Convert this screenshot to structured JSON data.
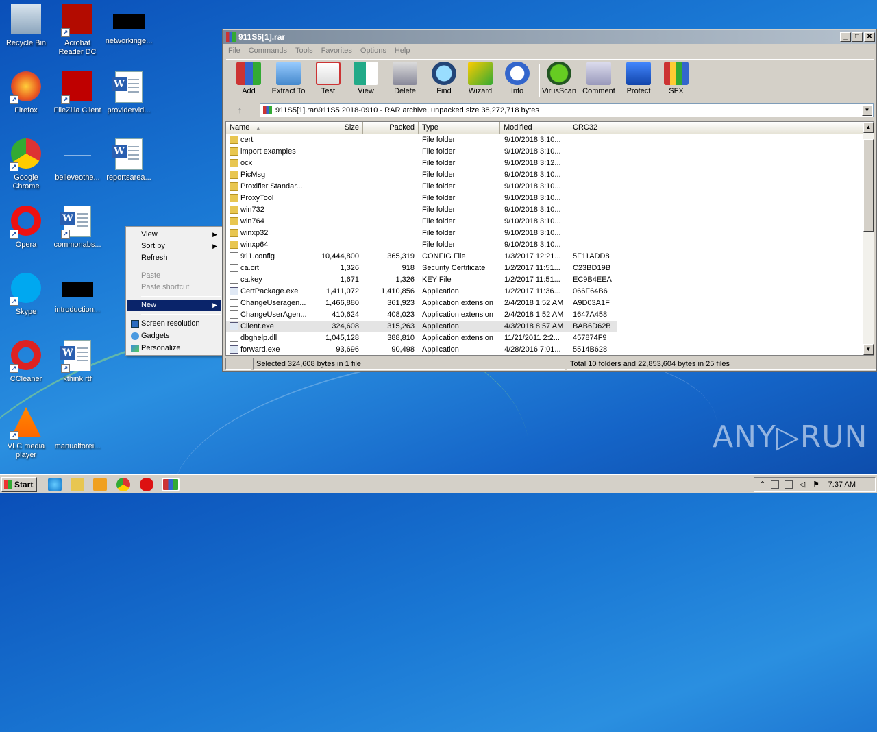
{
  "desktop": {
    "icons": [
      {
        "label": "Recycle Bin",
        "icon": "recycle-bin-icon"
      },
      {
        "label": "Acrobat Reader DC",
        "icon": "acrobat-icon"
      },
      {
        "label": "networkinge...",
        "icon": "redacted-icon"
      },
      {
        "label": "Firefox",
        "icon": "firefox-icon"
      },
      {
        "label": "FileZilla Client",
        "icon": "filezilla-icon"
      },
      {
        "label": "providervid...",
        "icon": "word-doc-icon"
      },
      {
        "label": "Google Chrome",
        "icon": "chrome-icon"
      },
      {
        "label": "believeothe...",
        "icon": "blank-icon"
      },
      {
        "label": "reportsarea...",
        "icon": "word-doc-icon"
      },
      {
        "label": "Opera",
        "icon": "opera-icon"
      },
      {
        "label": "commonabs...",
        "icon": "word-doc-icon"
      },
      {
        "label": "Skype",
        "icon": "skype-icon"
      },
      {
        "label": "introduction...",
        "icon": "redacted-icon"
      },
      {
        "label": "CCleaner",
        "icon": "ccleaner-icon"
      },
      {
        "label": "kthink.rtf",
        "icon": "word-doc-icon"
      },
      {
        "label": "VLC media player",
        "icon": "vlc-icon"
      },
      {
        "label": "manualforei...",
        "icon": "blank-icon"
      }
    ]
  },
  "context_menu": {
    "items": [
      {
        "label": "View",
        "sub": "▶"
      },
      {
        "label": "Sort by",
        "sub": "▶"
      },
      {
        "label": "Refresh"
      },
      {
        "label": "Paste"
      },
      {
        "label": "Paste shortcut"
      },
      {
        "label": "New",
        "sub": "▶"
      },
      {
        "label": "Screen resolution"
      },
      {
        "label": "Gadgets"
      },
      {
        "label": "Personalize"
      }
    ]
  },
  "window": {
    "title": "911S5[1].rar",
    "controls": {
      "minimize": "_",
      "maximize": "□",
      "close": "✕"
    },
    "menu": [
      "File",
      "Commands",
      "Tools",
      "Favorites",
      "Options",
      "Help"
    ],
    "toolbar": [
      "Add",
      "Extract To",
      "Test",
      "View",
      "Delete",
      "Find",
      "Wizard",
      "Info",
      "VirusScan",
      "Comment",
      "Protect",
      "SFX"
    ],
    "address": "911S5[1].rar\\911S5 2018-0910 - RAR archive, unpacked size 38,272,718 bytes",
    "up_arrow": "↑",
    "dropdown_arrow": "▼",
    "columns": [
      "Name",
      "Size",
      "Packed",
      "Type",
      "Modified",
      "CRC32"
    ],
    "sort_arrow": "▲",
    "rows": [
      {
        "name": "cert",
        "size": "",
        "packed": "",
        "type": "File folder",
        "modified": "9/10/2018 3:10...",
        "crc": "",
        "kind": "folder"
      },
      {
        "name": "import examples",
        "size": "",
        "packed": "",
        "type": "File folder",
        "modified": "9/10/2018 3:10...",
        "crc": "",
        "kind": "folder"
      },
      {
        "name": "ocx",
        "size": "",
        "packed": "",
        "type": "File folder",
        "modified": "9/10/2018 3:12...",
        "crc": "",
        "kind": "folder"
      },
      {
        "name": "PicMsg",
        "size": "",
        "packed": "",
        "type": "File folder",
        "modified": "9/10/2018 3:10...",
        "crc": "",
        "kind": "folder"
      },
      {
        "name": "Proxifier Standar...",
        "size": "",
        "packed": "",
        "type": "File folder",
        "modified": "9/10/2018 3:10...",
        "crc": "",
        "kind": "folder"
      },
      {
        "name": "ProxyTool",
        "size": "",
        "packed": "",
        "type": "File folder",
        "modified": "9/10/2018 3:10...",
        "crc": "",
        "kind": "folder"
      },
      {
        "name": "win732",
        "size": "",
        "packed": "",
        "type": "File folder",
        "modified": "9/10/2018 3:10...",
        "crc": "",
        "kind": "folder"
      },
      {
        "name": "win764",
        "size": "",
        "packed": "",
        "type": "File folder",
        "modified": "9/10/2018 3:10...",
        "crc": "",
        "kind": "folder"
      },
      {
        "name": "winxp32",
        "size": "",
        "packed": "",
        "type": "File folder",
        "modified": "9/10/2018 3:10...",
        "crc": "",
        "kind": "folder"
      },
      {
        "name": "winxp64",
        "size": "",
        "packed": "",
        "type": "File folder",
        "modified": "9/10/2018 3:10...",
        "crc": "",
        "kind": "folder"
      },
      {
        "name": "911.config",
        "size": "10,444,800",
        "packed": "365,319",
        "type": "CONFIG File",
        "modified": "1/3/2017 12:21...",
        "crc": "5F11ADD8",
        "kind": "file"
      },
      {
        "name": "ca.crt",
        "size": "1,326",
        "packed": "918",
        "type": "Security Certificate",
        "modified": "1/2/2017 11:51...",
        "crc": "C23BD19B",
        "kind": "file"
      },
      {
        "name": "ca.key",
        "size": "1,671",
        "packed": "1,326",
        "type": "KEY File",
        "modified": "1/2/2017 11:51...",
        "crc": "EC9B4EEA",
        "kind": "file"
      },
      {
        "name": "CertPackage.exe",
        "size": "1,411,072",
        "packed": "1,410,856",
        "type": "Application",
        "modified": "1/2/2017 11:36...",
        "crc": "066F64B6",
        "kind": "app"
      },
      {
        "name": "ChangeUseragen...",
        "size": "1,466,880",
        "packed": "361,923",
        "type": "Application extension",
        "modified": "2/4/2018 1:52 AM",
        "crc": "A9D03A1F",
        "kind": "file"
      },
      {
        "name": "ChangeUserAgen...",
        "size": "410,624",
        "packed": "408,023",
        "type": "Application extension",
        "modified": "2/4/2018 1:52 AM",
        "crc": "1647A458",
        "kind": "file"
      },
      {
        "name": "Client.exe",
        "size": "324,608",
        "packed": "315,263",
        "type": "Application",
        "modified": "4/3/2018 8:57 AM",
        "crc": "BAB6D62B",
        "kind": "app",
        "selected": true
      },
      {
        "name": "dbghelp.dll",
        "size": "1,045,128",
        "packed": "388,810",
        "type": "Application extension",
        "modified": "11/21/2011 2:2...",
        "crc": "457874F9",
        "kind": "file"
      },
      {
        "name": "forward.exe",
        "size": "93,696",
        "packed": "90,498",
        "type": "Application",
        "modified": "4/28/2016 7:01...",
        "crc": "5514B628",
        "kind": "app"
      }
    ],
    "status_left": "Selected 324,608 bytes in 1 file",
    "status_right": "Total 10 folders and 22,853,604 bytes in 25 files"
  },
  "taskbar": {
    "start": "Start",
    "clock": "7:37 AM"
  },
  "watermark": "ANY▷RUN"
}
